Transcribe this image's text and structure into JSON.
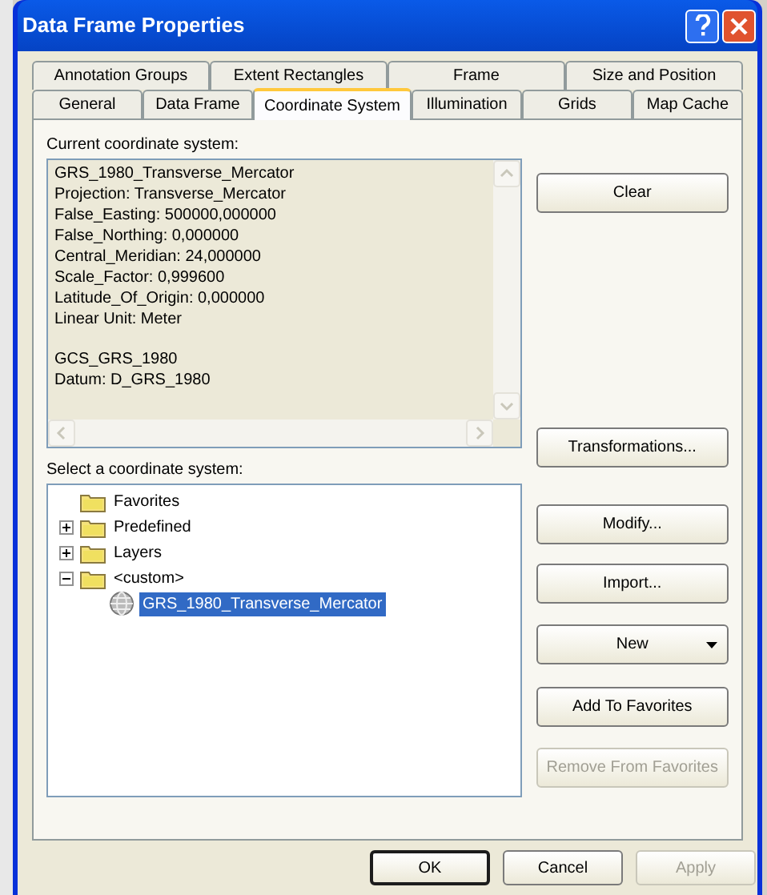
{
  "window": {
    "title": "Data Frame Properties"
  },
  "tab_rows": [
    [
      {
        "label": "Annotation Groups",
        "selected": false
      },
      {
        "label": "Extent Rectangles",
        "selected": false
      },
      {
        "label": "Frame",
        "selected": false
      },
      {
        "label": "Size and Position",
        "selected": false
      }
    ],
    [
      {
        "label": "General",
        "selected": false
      },
      {
        "label": "Data Frame",
        "selected": false
      },
      {
        "label": "Coordinate System",
        "selected": true
      },
      {
        "label": "Illumination",
        "selected": false
      },
      {
        "label": "Grids",
        "selected": false
      },
      {
        "label": "Map Cache",
        "selected": false
      }
    ]
  ],
  "current": {
    "label": "Current coordinate system:",
    "paragraphs": [
      [
        "GRS_1980_Transverse_Mercator",
        "Projection: Transverse_Mercator",
        "False_Easting: 500000,000000",
        "False_Northing: 0,000000",
        "Central_Meridian: 24,000000",
        "Scale_Factor: 0,999600",
        "Latitude_Of_Origin: 0,000000",
        "Linear Unit: Meter"
      ],
      [
        "GCS_GRS_1980",
        "Datum: D_GRS_1980"
      ]
    ]
  },
  "select": {
    "label": "Select a coordinate system:",
    "tree": [
      {
        "label": "Favorites",
        "kind": "folder",
        "selected": false
      },
      {
        "label": "Predefined",
        "kind": "folder",
        "expanded": false,
        "selected": false
      },
      {
        "label": "Layers",
        "kind": "folder",
        "expanded": false,
        "selected": false
      },
      {
        "label": "<custom>",
        "kind": "folder",
        "expanded": true,
        "selected": false,
        "children": [
          {
            "label": "GRS_1980_Transverse_Mercator",
            "kind": "projection",
            "selected": true
          }
        ]
      }
    ]
  },
  "side_buttons": [
    {
      "label": "Clear",
      "disabled": false,
      "kind": "plain"
    },
    {
      "label": "Transformations...",
      "disabled": false,
      "kind": "plain"
    },
    {
      "label": "Modify...",
      "disabled": false,
      "kind": "plain"
    },
    {
      "label": "Import...",
      "disabled": false,
      "kind": "plain"
    },
    {
      "label": "New",
      "disabled": false,
      "kind": "split"
    },
    {
      "label": "Add To Favorites",
      "disabled": false,
      "kind": "plain"
    },
    {
      "label": "Remove From Favorites",
      "disabled": true,
      "kind": "plain"
    }
  ],
  "dialog_buttons": [
    {
      "label": "OK",
      "disabled": false,
      "default": true
    },
    {
      "label": "Cancel",
      "disabled": false,
      "default": false
    },
    {
      "label": "Apply",
      "disabled": true,
      "default": false
    }
  ]
}
